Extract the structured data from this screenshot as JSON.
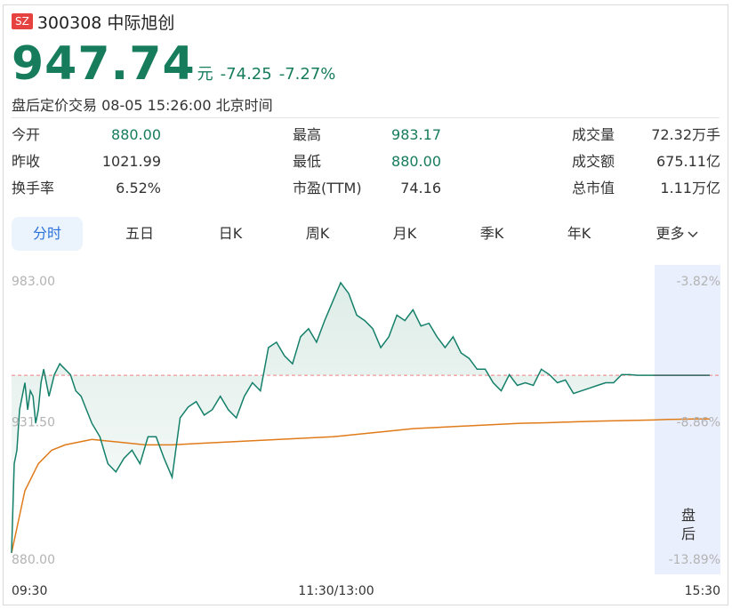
{
  "header": {
    "exchange_badge": "SZ",
    "title": "300308 中际旭创",
    "price": "947.74",
    "unit": "元",
    "change": "-74.25",
    "change_pct": "-7.27%",
    "session_text": "盘后定价交易 08-05 15:26:00 北京时间"
  },
  "stats": {
    "open_label": "今开",
    "open_value": "880.00",
    "prev_close_label": "昨收",
    "prev_close_value": "1021.99",
    "turnover_label": "换手率",
    "turnover_value": "6.52%",
    "high_label": "最高",
    "high_value": "983.17",
    "low_label": "最低",
    "low_value": "880.00",
    "pe_label": "市盈(TTM)",
    "pe_value": "74.16",
    "volume_label": "成交量",
    "volume_value": "72.32万手",
    "amount_label": "成交额",
    "amount_value": "675.11亿",
    "market_cap_label": "总市值",
    "market_cap_value": "1.11万亿"
  },
  "tabs": [
    "分时",
    "五日",
    "日K",
    "周K",
    "月K",
    "季K",
    "年K",
    "更多"
  ],
  "active_tab": "分时",
  "colors": {
    "down": "#177c5c",
    "price_line": "#15806a",
    "avg_line": "#e07b1a",
    "ref_line": "#f08080",
    "after_hours_bg": "#e9effc",
    "tab_active": "#2b72d8"
  },
  "chart_data": {
    "type": "line",
    "title": "",
    "y_left_ticks": [
      "983.00",
      "931.50",
      "880.00"
    ],
    "y_right_ticks": [
      "-3.82%",
      "-8.86%",
      "-13.89%"
    ],
    "x_ticks": [
      "09:30",
      "11:30/13:00",
      "15:30"
    ],
    "ylim": [
      880.0,
      983.0
    ],
    "reference_value": 947.74,
    "after_hours_label": "盘后",
    "grid": false,
    "series": [
      {
        "x": [
          0,
          1,
          2,
          3,
          4,
          5,
          6,
          7,
          8,
          9,
          10,
          11,
          12,
          14,
          16,
          18,
          20,
          22,
          24,
          26,
          28,
          30,
          33,
          36,
          39,
          42,
          45,
          48,
          51,
          54,
          57,
          60,
          63,
          66,
          69,
          72,
          75,
          78,
          81,
          84,
          87,
          90,
          93,
          96,
          99,
          102,
          105,
          108,
          111,
          114,
          117,
          120,
          123,
          126,
          129,
          132,
          135,
          138,
          141,
          144,
          147,
          150,
          153,
          156,
          159,
          162,
          165,
          168,
          171,
          174,
          177,
          180,
          183,
          186,
          189,
          192,
          195,
          198,
          201,
          204,
          207,
          210,
          213,
          216,
          219,
          222,
          225,
          228,
          231,
          234,
          237,
          240,
          242,
          246,
          250,
          260,
          270,
          280
        ],
        "values": [
          882,
          915,
          920,
          935,
          940,
          945,
          935,
          942,
          940,
          930,
          935,
          945,
          950,
          940,
          948,
          952,
          950,
          948,
          942,
          940,
          935,
          930,
          925,
          915,
          912,
          917,
          920,
          915,
          925,
          925,
          917,
          910,
          932,
          936,
          938,
          933,
          935,
          940,
          935,
          932,
          940,
          945,
          942,
          958,
          960,
          955,
          952,
          962,
          965,
          960,
          968,
          975,
          982,
          978,
          970,
          968,
          965,
          958,
          962,
          970,
          968,
          972,
          966,
          967,
          962,
          958,
          962,
          956,
          954,
          950,
          950,
          945,
          942,
          948,
          944,
          945,
          944,
          950,
          948,
          945,
          946,
          941,
          942,
          943,
          944,
          945,
          945,
          948,
          948,
          947.74,
          947.74,
          947.74,
          947.74,
          947.74,
          947.74,
          947.74,
          947.74,
          947.74
        ]
      },
      {
        "x": [
          0,
          5,
          10,
          15,
          20,
          30,
          40,
          50,
          60,
          70,
          80,
          90,
          100,
          110,
          120,
          130,
          140,
          150,
          160,
          170,
          180,
          190,
          200,
          210,
          220,
          230,
          240,
          250,
          260,
          270,
          280
        ],
        "values": [
          882,
          905,
          915,
          920,
          922,
          924,
          923,
          922,
          922,
          922.5,
          923,
          923.5,
          924,
          924.5,
          925,
          926,
          927,
          928,
          928.5,
          929,
          929.5,
          930,
          930.2,
          930.5,
          930.8,
          931,
          931.2,
          931.4,
          931.5,
          931.6,
          931.6
        ]
      }
    ]
  }
}
